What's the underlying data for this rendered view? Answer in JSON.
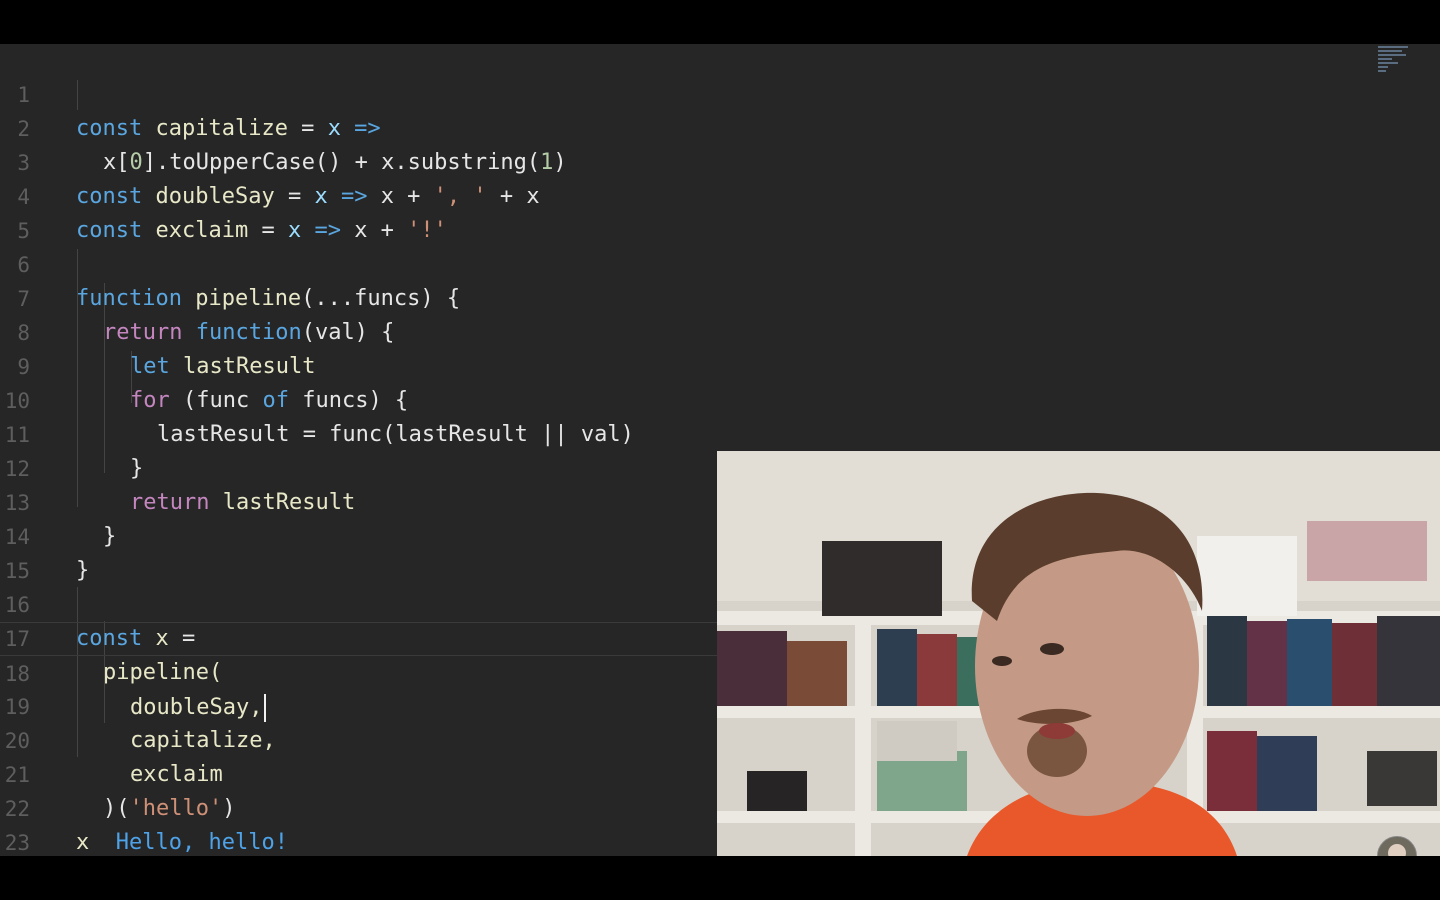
{
  "editor": {
    "line_numbers": [
      "1",
      "2",
      "3",
      "4",
      "5",
      "6",
      "7",
      "8",
      "9",
      "10",
      "11",
      "12",
      "13",
      "14",
      "15",
      "16",
      "17",
      "18",
      "19",
      "20",
      "21",
      "22",
      "23"
    ],
    "lines": {
      "l1": {
        "k": "const",
        "a": "capitalize",
        "b": " = ",
        "c": "x",
        "d": " =>"
      },
      "l2": {
        "a": "x[",
        "n": "0",
        "b": "].toUpperCase() + x.substring(",
        "n2": "1",
        "c": ")"
      },
      "l3": {
        "k": "const",
        "a": "doubleSay",
        "b": " = ",
        "c": "x",
        "d": " => ",
        "e": "x + ",
        "s": "', '",
        "f": " + x"
      },
      "l4": {
        "k": "const",
        "a": "exclaim",
        "b": " = ",
        "c": "x",
        "d": " => ",
        "e": "x + ",
        "s": "'!'"
      },
      "l6": {
        "k": "function",
        "a": "pipeline",
        "b": "(...funcs) {"
      },
      "l7": {
        "k": "return",
        "k2": "function",
        "b": "(val) {"
      },
      "l8": {
        "k": "let",
        "a": "lastResult"
      },
      "l9": {
        "k": "for",
        "b": " (func ",
        "k2": "of",
        "c": " funcs) {"
      },
      "l10": {
        "a": "lastResult = func(lastResult || val)"
      },
      "l11": {
        "a": "}"
      },
      "l12": {
        "k": "return",
        "a": "lastResult"
      },
      "l13": {
        "a": "}"
      },
      "l14": {
        "a": "}"
      },
      "l16": {
        "k": "const",
        "a": "x",
        "b": " ="
      },
      "l17": {
        "a": "pipeline("
      },
      "l18": {
        "a": "doubleSay,"
      },
      "l19": {
        "a": "capitalize,"
      },
      "l20": {
        "a": "exclaim"
      },
      "l21": {
        "a": ")(",
        "s": "'hello'",
        "b": ")"
      },
      "l22": {
        "a": "x",
        "r": "Hello, hello!"
      }
    }
  },
  "colors": {
    "background": "#262626",
    "keyword": "#5aa6e0",
    "string": "#ce9178",
    "result": "#4ea2e8"
  },
  "overlay": {
    "webcam": "presenter webcam",
    "avatar": "channel-avatar-icon"
  }
}
